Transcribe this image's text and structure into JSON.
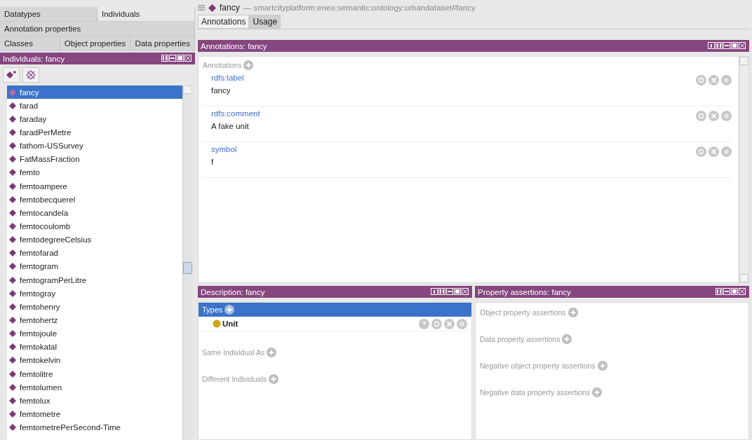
{
  "left_tabs": [
    [
      {
        "label": "Datatypes",
        "selected": false
      },
      {
        "label": "Individuals",
        "selected": true
      }
    ],
    [
      {
        "label": "Annotation properties",
        "selected": false
      }
    ],
    [
      {
        "label": "Classes",
        "selected": false
      },
      {
        "label": "Object properties",
        "selected": false
      },
      {
        "label": "Data properties",
        "selected": false
      }
    ]
  ],
  "individuals_panel": {
    "title": "Individuals: fancy",
    "items": [
      {
        "label": "fancy",
        "selected": true
      },
      {
        "label": "farad",
        "selected": false
      },
      {
        "label": "faraday",
        "selected": false
      },
      {
        "label": "faradPerMetre",
        "selected": false
      },
      {
        "label": "fathom-USSurvey",
        "selected": false
      },
      {
        "label": "FatMassFraction",
        "selected": false
      },
      {
        "label": "femto",
        "selected": false
      },
      {
        "label": "femtoampere",
        "selected": false
      },
      {
        "label": "femtobecquerel",
        "selected": false
      },
      {
        "label": "femtocandela",
        "selected": false
      },
      {
        "label": "femtocoulomb",
        "selected": false
      },
      {
        "label": "femtodegreeCelsius",
        "selected": false
      },
      {
        "label": "femtofarad",
        "selected": false
      },
      {
        "label": "femtogram",
        "selected": false
      },
      {
        "label": "femtogramPerLitre",
        "selected": false
      },
      {
        "label": "femtogray",
        "selected": false
      },
      {
        "label": "femtohenry",
        "selected": false
      },
      {
        "label": "femtohertz",
        "selected": false
      },
      {
        "label": "femtojoule",
        "selected": false
      },
      {
        "label": "femtokatal",
        "selected": false
      },
      {
        "label": "femtokelvin",
        "selected": false
      },
      {
        "label": "femtolitre",
        "selected": false
      },
      {
        "label": "femtolumen",
        "selected": false
      },
      {
        "label": "femtolux",
        "selected": false
      },
      {
        "label": "femtometre",
        "selected": false
      },
      {
        "label": "femtometrePerSecond-Time",
        "selected": false
      }
    ]
  },
  "entity_bar": {
    "name": "fancy",
    "iri": "— smartcityplatform:enea:semantic:ontology:urbandataset#fancy"
  },
  "main_tabs": [
    {
      "label": "Annotations",
      "selected": true
    },
    {
      "label": "Usage",
      "selected": false
    }
  ],
  "annotations_panel": {
    "title": "Annotations: fancy",
    "section": "Annotations",
    "entries": [
      {
        "property": "rdfs:label",
        "value": "fancy"
      },
      {
        "property": "rdfs:comment",
        "value": "A fake unit"
      },
      {
        "property": "symbol",
        "value": "f"
      }
    ]
  },
  "description_panel": {
    "title": "Description: fancy",
    "types_header": "Types",
    "types": [
      {
        "label": "Unit"
      }
    ],
    "sections": [
      "Same Individual As",
      "Different Individuals"
    ]
  },
  "property_panel": {
    "title": "Property assertions: fancy",
    "sections": [
      "Object property assertions",
      "Data property assertions",
      "Negative object property assertions",
      "Negative data property assertions"
    ]
  }
}
